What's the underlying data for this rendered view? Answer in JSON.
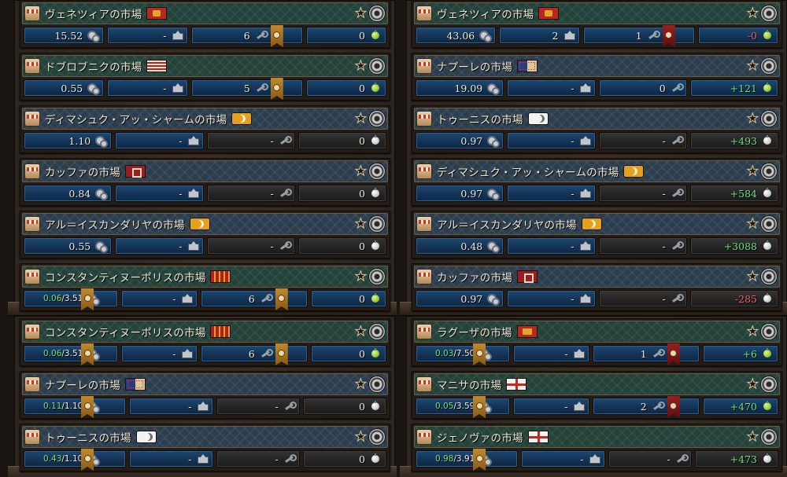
{
  "labels": {
    "dash": "-"
  },
  "left_top": [
    {
      "title": "ヴェネツィアの市場",
      "flag": "venice",
      "theme": "green",
      "stats": [
        {
          "value": "15.52"
        },
        {
          "value": "-"
        },
        {
          "value": "6",
          "ribbon": "gold"
        },
        {
          "value": "0",
          "bulb": "green"
        }
      ]
    },
    {
      "title": "ドブロブニクの市場",
      "flag": "dubrovnik",
      "theme": "green",
      "stats": [
        {
          "value": "0.55"
        },
        {
          "value": "-"
        },
        {
          "value": "5",
          "ribbon": "gold"
        },
        {
          "value": "0",
          "bulb": "green"
        }
      ]
    },
    {
      "title": "ディマシュク・アッ・シャームの市場",
      "flag": "crescent",
      "theme": "blue",
      "stats": [
        {
          "value": "1.10"
        },
        {
          "value": "-"
        },
        {
          "value": "-",
          "dark": true
        },
        {
          "value": "0",
          "dark": true,
          "bulb": "white"
        }
      ]
    },
    {
      "title": "カッファの市場",
      "flag": "kaffa",
      "theme": "blue",
      "stats": [
        {
          "value": "0.84"
        },
        {
          "value": "-"
        },
        {
          "value": "-",
          "dark": true
        },
        {
          "value": "0",
          "dark": true,
          "bulb": "white"
        }
      ]
    },
    {
      "title": "アル＝イスカンダリヤの市場",
      "flag": "crescent",
      "theme": "blue",
      "stats": [
        {
          "value": "0.55"
        },
        {
          "value": "-"
        },
        {
          "value": "-",
          "dark": true
        },
        {
          "value": "0",
          "dark": true,
          "bulb": "white"
        }
      ]
    },
    {
      "title": "コンスタンティヌーポリスの市場",
      "flag": "const",
      "theme": "green",
      "stats": [
        {
          "low": "0.06",
          "high": "/3.51",
          "ribbon_left": true
        },
        {
          "value": "-"
        },
        {
          "value": "6",
          "ribbon": "gold"
        },
        {
          "value": "0",
          "bulb": "green"
        }
      ]
    }
  ],
  "right_top": [
    {
      "title": "ヴェネツィアの市場",
      "flag": "venice",
      "theme": "green",
      "stats": [
        {
          "value": "43.06"
        },
        {
          "value": "2"
        },
        {
          "value": "1",
          "ribbon": "red"
        },
        {
          "value": "-0",
          "tone": "neg",
          "bulb": "green"
        }
      ]
    },
    {
      "title": "ナプーレの市場",
      "flag": "naples",
      "theme": "blue",
      "stats": [
        {
          "value": "19.09"
        },
        {
          "value": "-"
        },
        {
          "value": "0",
          "wrench_red": true
        },
        {
          "value": "+121",
          "tone": "pos",
          "bulb": "green"
        }
      ]
    },
    {
      "title": "トゥーニスの市場",
      "flag": "crescent-white",
      "theme": "blue",
      "stats": [
        {
          "value": "0.97"
        },
        {
          "value": "-"
        },
        {
          "value": "-",
          "dark": true
        },
        {
          "value": "+493",
          "tone": "pos",
          "dark": true,
          "bulb": "white"
        }
      ]
    },
    {
      "title": "ディマシュク・アッ・シャームの市場",
      "flag": "crescent",
      "theme": "blue",
      "stats": [
        {
          "value": "0.97"
        },
        {
          "value": "-"
        },
        {
          "value": "-",
          "dark": true
        },
        {
          "value": "+584",
          "tone": "pos",
          "dark": true,
          "bulb": "white"
        }
      ]
    },
    {
      "title": "アル＝イスカンダリヤの市場",
      "flag": "crescent",
      "theme": "blue",
      "stats": [
        {
          "value": "0.48"
        },
        {
          "value": "-"
        },
        {
          "value": "-",
          "dark": true
        },
        {
          "value": "+3088",
          "tone": "pos",
          "dark": true,
          "bulb": "white"
        }
      ]
    },
    {
      "title": "カッファの市場",
      "flag": "kaffa",
      "theme": "blue",
      "stats": [
        {
          "value": "0.97"
        },
        {
          "value": "-"
        },
        {
          "value": "-",
          "dark": true
        },
        {
          "value": "-285",
          "tone": "neg",
          "dark": true,
          "bulb": "white"
        }
      ]
    }
  ],
  "left_bottom": [
    {
      "title": "コンスタンティヌーポリスの市場",
      "flag": "const",
      "theme": "green",
      "stats": [
        {
          "low": "0.06",
          "high": "/3.51",
          "ribbon_left": true
        },
        {
          "value": "-"
        },
        {
          "value": "6",
          "ribbon": "gold"
        },
        {
          "value": "0",
          "bulb": "green"
        }
      ]
    },
    {
      "title": "ナプーレの市場",
      "flag": "naples",
      "theme": "blue",
      "stats": [
        {
          "low": "0.11",
          "high": "/1.10",
          "ribbon_left": true
        },
        {
          "value": "-"
        },
        {
          "value": "-",
          "dark": true
        },
        {
          "value": "0",
          "dark": true,
          "bulb": "white"
        }
      ]
    },
    {
      "title": "トゥーニスの市場",
      "flag": "crescent-white",
      "theme": "blue",
      "stats": [
        {
          "low": "0.43",
          "high": "/1.10",
          "ribbon_left": true
        },
        {
          "value": "-"
        },
        {
          "value": "-",
          "dark": true
        },
        {
          "value": "0",
          "dark": true,
          "bulb": "white"
        }
      ]
    }
  ],
  "right_bottom": [
    {
      "title": "ラグーザの市場",
      "flag": "ragusa",
      "theme": "green",
      "stats": [
        {
          "low": "0.03",
          "high": "/7.50",
          "ribbon_left": true
        },
        {
          "value": "-"
        },
        {
          "value": "1",
          "ribbon": "red"
        },
        {
          "value": "+6",
          "tone": "pos",
          "bulb": "green"
        }
      ]
    },
    {
      "title": "マニサの市場",
      "flag": "genoa",
      "theme": "green",
      "stats": [
        {
          "low": "0.05",
          "high": "/3.59",
          "ribbon_left": true
        },
        {
          "value": "-"
        },
        {
          "value": "2",
          "ribbon": "red"
        },
        {
          "value": "+470",
          "tone": "pos",
          "bulb": "green"
        }
      ]
    },
    {
      "title": "ジェノヴァの市場",
      "flag": "genoa",
      "theme": "green",
      "stats": [
        {
          "low": "0.98",
          "high": "/3.91",
          "ribbon_left": true
        },
        {
          "value": "-"
        },
        {
          "value": "-",
          "dark": true
        },
        {
          "value": "+473",
          "tone": "pos",
          "dark": true,
          "bulb": "white"
        }
      ]
    }
  ]
}
